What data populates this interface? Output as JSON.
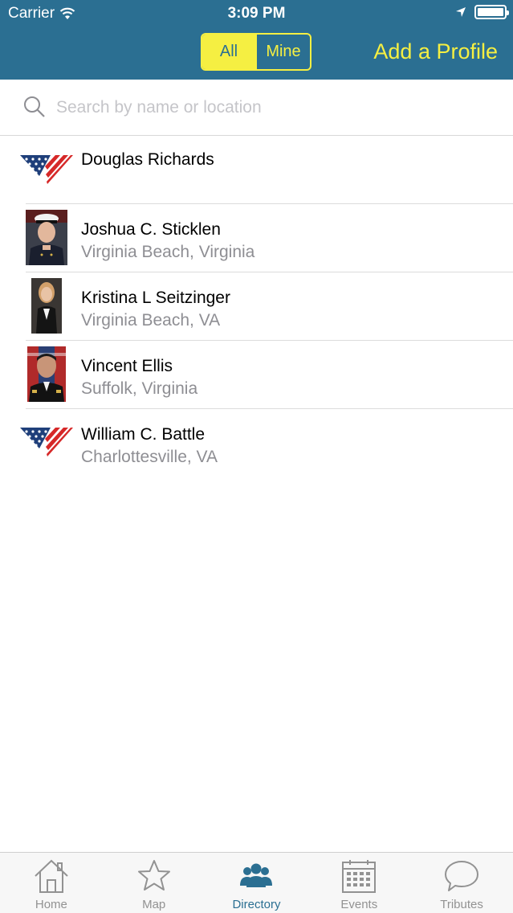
{
  "status_bar": {
    "carrier": "Carrier",
    "time": "3:09 PM"
  },
  "nav": {
    "segments": [
      "All",
      "Mine"
    ],
    "selected_segment": "All",
    "add_profile": "Add a Profile"
  },
  "search": {
    "placeholder": "Search by name or location"
  },
  "profiles": [
    {
      "name": "Douglas Richards",
      "location": "",
      "avatar": "flag-emblem"
    },
    {
      "name": "Joshua C. Sticklen",
      "location": "Virginia Beach, Virginia",
      "avatar": "photo"
    },
    {
      "name": "Kristina L Seitzinger",
      "location": "Virginia Beach, VA",
      "avatar": "photo"
    },
    {
      "name": "Vincent Ellis",
      "location": "Suffolk, Virginia",
      "avatar": "photo"
    },
    {
      "name": "William C. Battle",
      "location": "Charlottesville, VA",
      "avatar": "flag-emblem"
    }
  ],
  "tabs": [
    {
      "label": "Home",
      "icon": "home-icon"
    },
    {
      "label": "Map",
      "icon": "star-icon"
    },
    {
      "label": "Directory",
      "icon": "people-icon",
      "active": true
    },
    {
      "label": "Events",
      "icon": "calendar-icon"
    },
    {
      "label": "Tributes",
      "icon": "speech-bubble-icon"
    }
  ],
  "colors": {
    "header": "#2b6f92",
    "accent": "#f5ef42",
    "secondary_text": "#8e8e93"
  }
}
